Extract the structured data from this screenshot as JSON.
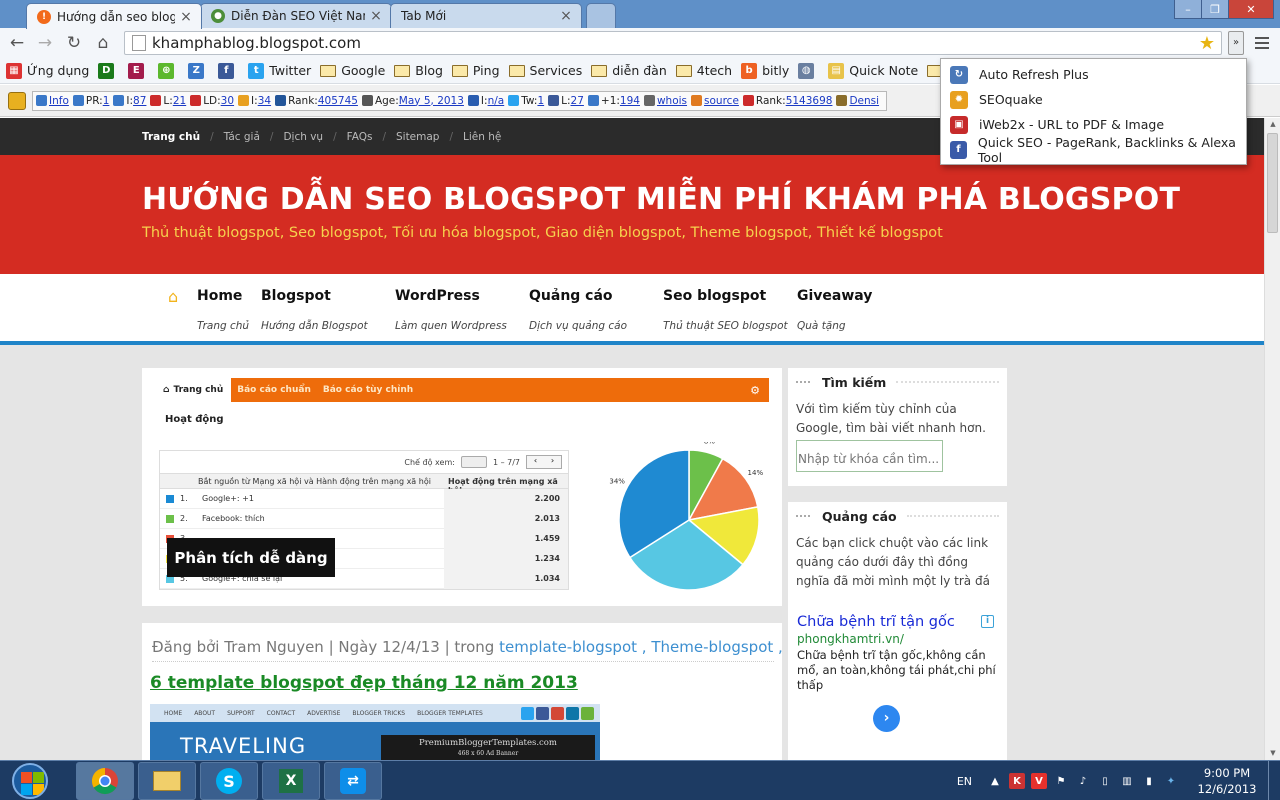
{
  "browser": {
    "tabs": [
      {
        "title": "Hướng dẫn seo blogspot m",
        "favicon_color": "#f26a1b",
        "favicon_glyph": "!",
        "active": true
      },
      {
        "title": "Diễn Đàn SEO Việt Nam - l",
        "favicon_color": "#4c8e3a",
        "favicon_glyph": "●",
        "active": false
      },
      {
        "title": "Tab Mới",
        "favicon_color": "",
        "favicon_glyph": "",
        "active": false
      }
    ],
    "url": "khamphablog.blogspot.com",
    "window_buttons": {
      "minimize": "–",
      "maximize": "❐",
      "close": "✕"
    }
  },
  "bookmarks": [
    {
      "label": "Ứng dụng",
      "icon": "apps-icon",
      "color": "#d33"
    },
    {
      "label": "",
      "icon": "D",
      "color": "#1a7a1a"
    },
    {
      "label": "",
      "icon": "E",
      "color": "#a31c4c"
    },
    {
      "label": "",
      "icon": "⊕",
      "color": "#5cb82e"
    },
    {
      "label": "",
      "icon": "Z",
      "color": "#3a78c8"
    },
    {
      "label": "",
      "icon": "f",
      "color": "#3b5998"
    },
    {
      "label": "Twitter",
      "icon": "twitter-icon",
      "color": "#2aa3ef"
    },
    {
      "label": "Google",
      "icon": "folder"
    },
    {
      "label": "Blog",
      "icon": "folder"
    },
    {
      "label": "Ping",
      "icon": "folder"
    },
    {
      "label": "Services",
      "icon": "folder"
    },
    {
      "label": "diễn đàn",
      "icon": "folder"
    },
    {
      "label": "4tech",
      "icon": "folder"
    },
    {
      "label": "bitly",
      "icon": "bitly-icon",
      "color": "#ee6123"
    },
    {
      "label": "",
      "icon": "◍",
      "color": "#6a7fa0"
    },
    {
      "label": "Quick Note",
      "icon": "note-icon",
      "color": "#e8c34a"
    },
    {
      "label": "money",
      "icon": "folder"
    }
  ],
  "seobar": [
    {
      "label": "Info",
      "link": true,
      "color": "#3a78c8"
    },
    {
      "label": "PR: ",
      "value": "1",
      "color": "#3a78c8"
    },
    {
      "label": "I: ",
      "value": "87",
      "color": "#3a78c8"
    },
    {
      "label": "L: ",
      "value": "21",
      "color": "#cc2a2a"
    },
    {
      "label": "LD: ",
      "value": "30",
      "color": "#cc2a2a"
    },
    {
      "label": "I: ",
      "value": "34",
      "color": "#e8a020"
    },
    {
      "label": "Rank: ",
      "value": "405745",
      "color": "#225599"
    },
    {
      "label": "Age: ",
      "value": "May 5, 2013",
      "color": "#555"
    },
    {
      "label": "I: ",
      "value": "n/a",
      "color": "#2a5db0"
    },
    {
      "label": "Tw: ",
      "value": "1",
      "color": "#2aa3ef"
    },
    {
      "label": "L: ",
      "value": "27",
      "color": "#3b5998"
    },
    {
      "label": "+1: ",
      "value": "194",
      "color": "#3a78c8"
    },
    {
      "label": "",
      "value": "whois",
      "color": "#666"
    },
    {
      "label": "",
      "value": "source",
      "color": "#e07a20"
    },
    {
      "label": "Rank: ",
      "value": "5143698",
      "color": "#cc2a2a"
    },
    {
      "label": "",
      "value": "Densi",
      "color": "#8a6d2b"
    }
  ],
  "extensions_menu": [
    {
      "label": "Auto Refresh Plus",
      "icon": "refresh-icon",
      "color": "#4a78b8"
    },
    {
      "label": "SEOquake",
      "icon": "gear-icon",
      "color": "#e8a020"
    },
    {
      "label": "iWeb2x - URL to PDF & Image",
      "icon": "pdf-icon",
      "color": "#c62a2a"
    },
    {
      "label": "Quick SEO - PageRank, Backlinks & Alexa Tool",
      "icon": "seo-icon",
      "color": "#3a5aa8"
    }
  ],
  "site": {
    "topnav": [
      "Trang chủ",
      "Tác giả",
      "Dịch vụ",
      "FAQs",
      "Sitemap",
      "Liên hệ"
    ],
    "title": "HƯỚNG DẪN SEO BLOGSPOT MIỄN PHÍ KHÁM PHÁ BLOGSPOT",
    "tagline": "Thủ thuật blogspot, Seo blogspot, Tối ưu hóa blogspot, Giao diện blogspot, Theme blogspot, Thiết kế blogspot",
    "menu": [
      {
        "title": "Home",
        "sub": "Trang chủ"
      },
      {
        "title": "Blogspot",
        "sub": "Hướng dẫn Blogspot"
      },
      {
        "title": "WordPress",
        "sub": "Làm quen Wordpress"
      },
      {
        "title": "Quảng cáo",
        "sub": "Dịch vụ quảng cáo"
      },
      {
        "title": "Seo blogspot",
        "sub": "Thủ thuật SEO blogspot"
      },
      {
        "title": "Giveaway",
        "sub": "Quà tặng"
      }
    ]
  },
  "slider": {
    "caption": "Phân tích dễ dàng",
    "ga": {
      "tab_home": "Trang chủ",
      "tab_std": "Báo cáo chuẩn",
      "tab_custom": "Báo cáo tùy chỉnh",
      "heading": "Hoạt động",
      "view_mode": "Chế độ xem:",
      "pager": "1 – 7/7",
      "col_source": "Bắt nguồn từ Mạng xã hội và Hành động trên mạng xã hội",
      "col_activity": "Hoạt động trên mạng xã hội",
      "rows": [
        {
          "n": "1.",
          "name": "Google+: +1",
          "value": "2.200",
          "color": "#1a8ad4"
        },
        {
          "n": "2.",
          "name": "Facebook: thích",
          "value": "2.013",
          "color": "#6cc04a"
        },
        {
          "n": "3.",
          "name": "",
          "value": "1.459",
          "color": "#e8503a"
        },
        {
          "n": "4.",
          "name": "",
          "value": "1.234",
          "color": "#f2e23a"
        },
        {
          "n": "5.",
          "name": "Google+: chia sẻ lại",
          "value": "1.034",
          "color": "#57c7e3"
        }
      ],
      "pie": [
        {
          "pct": 8,
          "label": "8%",
          "color": "#6cc04a"
        },
        {
          "pct": 14,
          "label": "14%",
          "color": "#f07a4a"
        },
        {
          "pct": 14,
          "label": "",
          "color": "#f0e83a"
        },
        {
          "pct": 30,
          "label": "30%",
          "color": "#57c7e3"
        },
        {
          "pct": 34,
          "label": "34%",
          "color": "#1f8ad2"
        }
      ]
    }
  },
  "post": {
    "meta_prefix": "Đăng bởi Tram Nguyen | Ngày 12/4/13 | trong ",
    "cat1": "template-blogspot",
    "cat_sep": " , ",
    "cat2": "Theme-blogspot",
    "cat_end": " ,",
    "title": "6 template blogspot đẹp tháng 12 năm 2013",
    "img_nav": [
      "HOME",
      "ABOUT",
      "SUPPORT",
      "CONTACT",
      "ADVERTISE",
      "BLOGGER TRICKS",
      "BLOGGER TEMPLATES"
    ],
    "img_title": "TRAVELING",
    "img_ad_line1": "PremiumBloggerTemplates.com",
    "img_ad_line2": "468 x 60 Ad Banner"
  },
  "sidebar": {
    "search": {
      "title": "Tìm kiếm",
      "desc": "Với tìm kiếm tùy chỉnh của Google, tìm bài viết nhanh hơn.",
      "placeholder": "Nhập từ khóa cần tìm..."
    },
    "ads": {
      "title": "Quảng cáo",
      "desc": "Các bạn click chuột vào các link quảng cáo dưới đây thì đồng nghĩa đã mời mình một ly trà đá",
      "ad_headline": "Chữa bệnh trĩ tận gốc",
      "ad_url": "phongkhamtri.vn/",
      "ad_desc": "Chữa bệnh trĩ tận gốc,không cần mổ, an toàn,không tái phát,chi phí thấp"
    }
  },
  "taskbar": {
    "lang": "EN",
    "time": "9:00 PM",
    "date": "12/6/2013"
  }
}
